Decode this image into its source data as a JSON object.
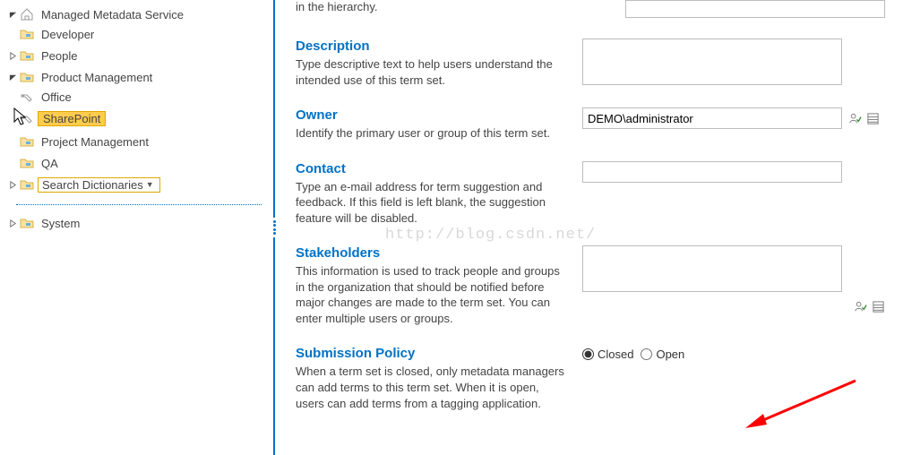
{
  "tree": {
    "root": "Managed Metadata Service",
    "items": {
      "developer": "Developer",
      "people": "People",
      "product_mgmt": "Product Management",
      "office": "Office",
      "sharepoint": "SharePoint",
      "project_mgmt": "Project Management",
      "qa": "QA",
      "search_dict": "Search Dictionaries",
      "system": "System"
    }
  },
  "top": {
    "fragment": "in the hierarchy."
  },
  "sections": {
    "description": {
      "title": "Description",
      "help": "Type descriptive text to help users understand the intended use of this term set."
    },
    "owner": {
      "title": "Owner",
      "help": "Identify the primary user or group of this term set.",
      "value": "DEMO\\administrator"
    },
    "contact": {
      "title": "Contact",
      "help": "Type an e-mail address for term suggestion and feedback. If this field is left blank, the suggestion feature will be disabled."
    },
    "stakeholders": {
      "title": "Stakeholders",
      "help": "This information is used to track people and groups in the organization that should be notified before major changes are made to the term set. You can enter multiple users or groups."
    },
    "submission": {
      "title": "Submission Policy",
      "help": "When a term set is closed, only metadata managers can add terms to this term set. When it is open, users can add terms from a tagging application.",
      "closed_label": "Closed",
      "open_label": "Open",
      "selected": "closed"
    }
  },
  "watermark": "http://blog.csdn.net/"
}
